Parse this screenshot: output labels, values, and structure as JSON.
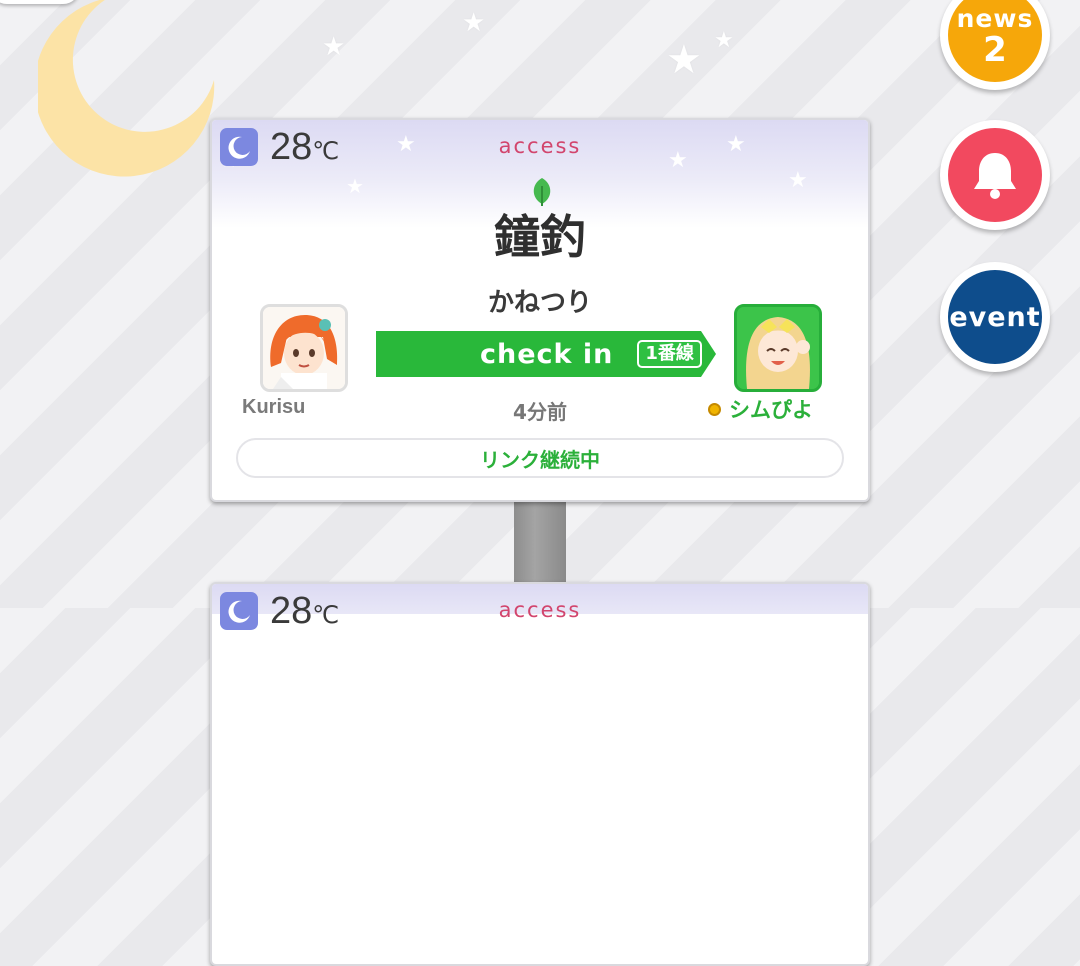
{
  "top_left_pill": "",
  "side_buttons": {
    "news_label": "news",
    "news_count": "2",
    "bell_icon": "bell-icon",
    "event_label": "event"
  },
  "card": {
    "weather_icon": "moon-icon",
    "temperature": "28",
    "temperature_unit": "℃",
    "category": "access",
    "leaf_icon": "leaf-icon",
    "station_name": "鐘釣",
    "station_reading": "かねつり",
    "left_user": {
      "name": "Kurisu"
    },
    "right_user": {
      "name": "シムぴよ"
    },
    "checkin_label": "check in",
    "track_label": "1番線",
    "time_ago": "4分前",
    "link_status": "リンク継続中"
  },
  "next_card": {
    "temperature": "28",
    "temperature_unit": "℃",
    "category": "access"
  },
  "colors": {
    "news": "#f6a70a",
    "bell": "#f2495f",
    "event": "#0e4d8c",
    "checkin": "#29b83a",
    "access": "#d2456d"
  }
}
